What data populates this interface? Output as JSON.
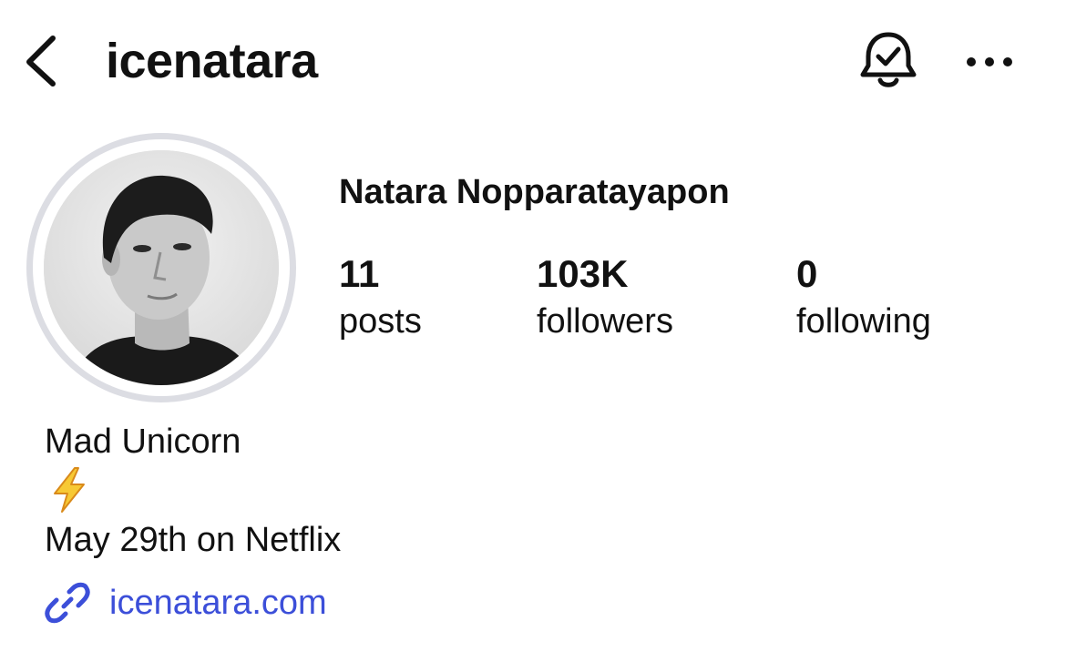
{
  "header": {
    "username": "icenatara",
    "back_icon": "chevron-left-icon",
    "notification_icon": "bell-check-icon",
    "more_icon": "more-horizontal-icon"
  },
  "profile": {
    "display_name": "Natara Nopparatayapon",
    "avatar": "profile-photo",
    "stats": {
      "posts": {
        "value": "11",
        "label": "posts"
      },
      "followers": {
        "value": "103K",
        "label": "followers"
      },
      "following": {
        "value": "0",
        "label": "following"
      }
    }
  },
  "bio": {
    "line1": "Mad Unicorn",
    "emoji": "⚡",
    "line3": "May 29th on Netflix",
    "link_icon": "link-icon",
    "link_text": "icenatara.com"
  },
  "colors": {
    "link": "#3c4fd9",
    "text": "#111111",
    "avatar_ring": "#dcdde3"
  }
}
